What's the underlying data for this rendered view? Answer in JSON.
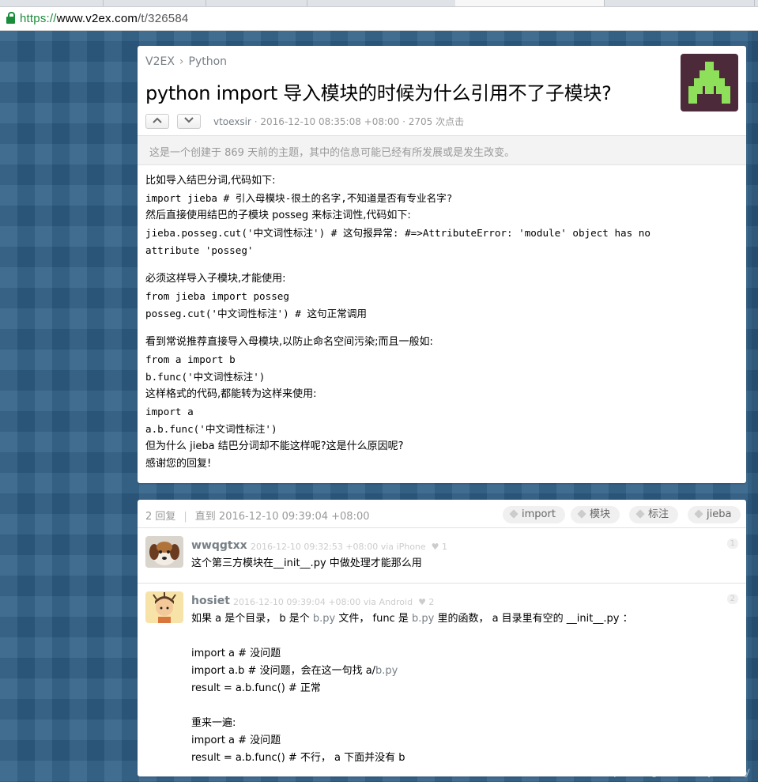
{
  "browser": {
    "url_scheme": "https://",
    "url_host": "www.v2ex.com",
    "url_path": "/t/326584"
  },
  "topic": {
    "breadcrumb": {
      "site": "V2EX",
      "separator": "›",
      "node": "Python"
    },
    "title": "python import 导入模块的时候为什么引用不了子模块?",
    "author": "vtoexsir",
    "meta_rest": " · 2016-12-10 08:35:08 +08:00 · 2705 次点击",
    "upvote_icon": "chevron-up-icon",
    "downvote_icon": "chevron-down-icon",
    "notice": "这是一个创建于 869 天前的主题，其中的信息可能已经有所发展或是发生改变。",
    "avatar_colors": {
      "bg": "#4d2a3a",
      "fg": "#8ee05a"
    },
    "content_blocks": [
      [
        {
          "text": "比如导入结巴分词,代码如下:",
          "code": false
        },
        {
          "text": "import jieba # 引入母模块-很土的名字,不知道是否有专业名字?",
          "code": true
        },
        {
          "text": "然后直接使用结巴的子模块 posseg 来标注词性,代码如下:",
          "code": false
        },
        {
          "text": "jieba.posseg.cut('中文词性标注') # 这句报异常: #=>AttributeError: 'module' object has no",
          "code": true
        },
        {
          "text": "attribute 'posseg'",
          "code": true
        }
      ],
      [
        {
          "text": "必须这样导入子模块,才能使用:",
          "code": false
        },
        {
          "text": "from jieba import posseg",
          "code": true
        },
        {
          "text": "posseg.cut('中文词性标注') # 这句正常调用",
          "code": true
        }
      ],
      [
        {
          "text": "看到常说推荐直接导入母模块,以防止命名空间污染;而且一般如:",
          "code": false
        },
        {
          "text": "from a import b",
          "code": true
        },
        {
          "text": "b.func('中文词性标注')",
          "code": true
        },
        {
          "text": "这样格式的代码,都能转为这样来使用:",
          "code": false
        },
        {
          "text": "import a",
          "code": true
        },
        {
          "text": "a.b.func('中文词性标注')",
          "code": true
        },
        {
          "text": "但为什么 jieba 结巴分词却不能这样呢?这是什么原因呢?",
          "code": false
        },
        {
          "text": "感谢您的回复!",
          "code": false
        }
      ]
    ]
  },
  "replies_header": {
    "count": "2 回复",
    "separator": "|",
    "last_reply": "直到 2016-12-10 09:39:04 +08:00",
    "tags": [
      "import",
      "模块",
      "标注",
      "jieba"
    ]
  },
  "replies": [
    {
      "user": "wwqgtxx",
      "time": "2016-12-10 09:32:53 +08:00 via iPhone",
      "likes": "♥ 1",
      "number": "1",
      "text": "这个第三方模块在__init__.py 中做处理才能那么用"
    },
    {
      "user": "hosiet",
      "time": "2016-12-10 09:39:04 +08:00 via Android",
      "likes": "♥ 2",
      "number": "2",
      "intro": {
        "p1": "如果 a 是个目录， b 是个 ",
        "l1": "b.py",
        "p2": " 文件， func 是 ",
        "l2": "b.py",
        "p3": " 里的函数， a 目录里有空的 __init__.py ："
      },
      "block1": {
        "l1": "import a # 没问题",
        "l2a": "import a.b # 没问题，会在这一句找 a/",
        "l2b": "b.py",
        "l3": "result = a.b.func() # 正常"
      },
      "block2": {
        "l1": "重来一遍:",
        "l2": "import a # 没问题",
        "l3": "result = a.b.func() # 不行， a 下面并没有 b"
      }
    }
  ],
  "watermark": "https://blog.csdn.net/yocency"
}
